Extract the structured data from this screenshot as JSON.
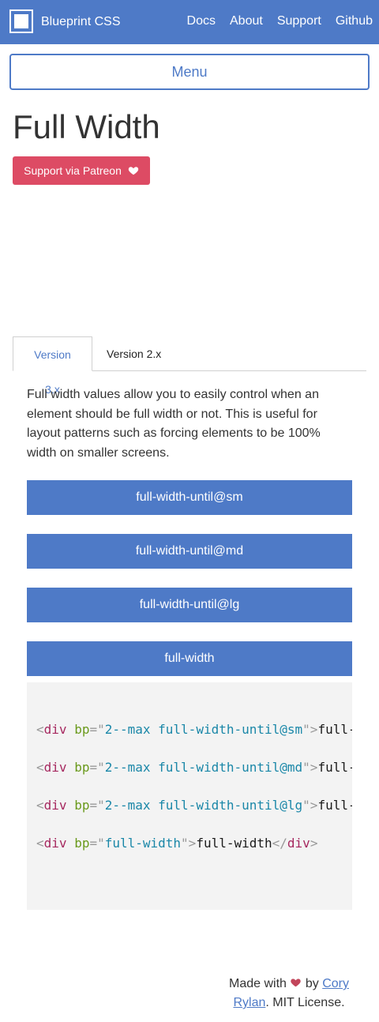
{
  "header": {
    "brand": "Blueprint CSS",
    "nav": [
      "Docs",
      "About",
      "Support",
      "Github"
    ]
  },
  "menu_label": "Menu",
  "page_title": "Full Width",
  "patreon_label": "Support via Patreon",
  "tabs": [
    "Version 3.x",
    "Version 2.x"
  ],
  "description": "Full width values allow you to easily control when an element should be full width or not. This is useful for layout patterns such as forcing elements to be 100% width on smaller screens.",
  "demo_boxes": [
    "full-width-until@sm",
    "full-width-until@md",
    "full-width-until@lg",
    "full-width"
  ],
  "code": [
    {
      "tag": "div",
      "attr": "bp",
      "value": "2--max full-width-until@sm",
      "text": "full-",
      "close": ""
    },
    {
      "tag": "div",
      "attr": "bp",
      "value": "2--max full-width-until@md",
      "text": "full-",
      "close": ""
    },
    {
      "tag": "div",
      "attr": "bp",
      "value": "2--max full-width-until@lg",
      "text": "full-",
      "close": ""
    },
    {
      "tag": "div",
      "attr": "bp",
      "value": "full-width",
      "text": "full-width",
      "close": "div"
    }
  ],
  "footer": {
    "made_with": "Made with",
    "by": "by",
    "author": "Cory Rylan",
    "license": ". MIT License."
  },
  "colors": {
    "primary": "#4e7ac7",
    "patreon": "#dd4b64",
    "code_bg": "#f3f3f3"
  },
  "icons": [
    "logo-icon",
    "heart-icon"
  ]
}
